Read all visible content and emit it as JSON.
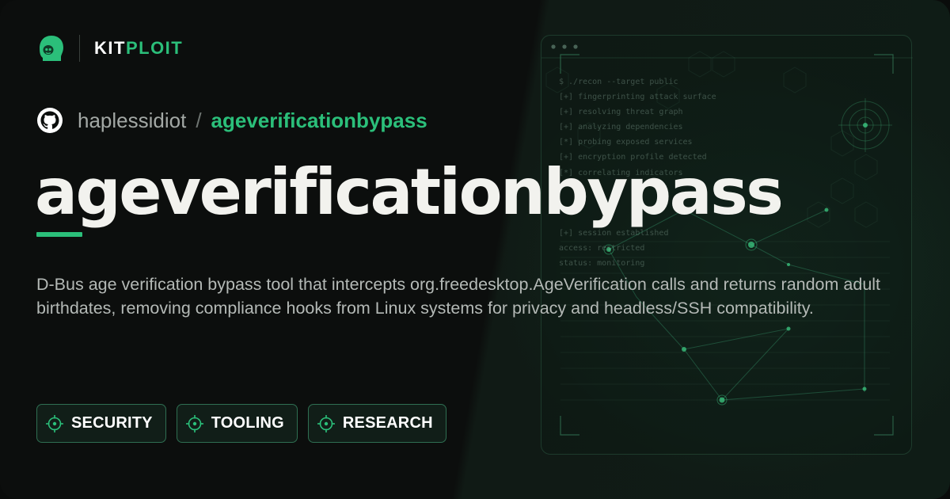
{
  "brand": {
    "part1": "KIT",
    "part2": "PLOIT",
    "logo_icon": "kitploit-helmet-icon"
  },
  "repo": {
    "owner": "haplessidiot",
    "separator": "/",
    "name": "ageverificationbypass",
    "icon": "github-icon"
  },
  "title": "ageverificationbypass",
  "description": "D-Bus age verification bypass tool that intercepts org.freedesktop.AgeVerification calls and returns random adult birthdates, removing compliance hooks from Linux systems for privacy and headless/SSH compatibility.",
  "tags": [
    {
      "label": "SECURITY",
      "icon": "crosshair-icon"
    },
    {
      "label": "TOOLING",
      "icon": "crosshair-icon"
    },
    {
      "label": "RESEARCH",
      "icon": "crosshair-icon"
    }
  ],
  "terminal": {
    "lines": [
      "$ ./recon --target public",
      "[+] fingerprinting attack surface",
      "[+] resolving threat graph",
      "[+] analyzing dependencies",
      "[*] probing exposed services",
      "[+] encryption profile detected",
      "[*] correlating indicators",
      "",
      "",
      "",
      "[+] session established",
      "access: restricted",
      "status: monitoring"
    ]
  },
  "colors": {
    "accent": "#2bbf7a",
    "background": "#0b0d0c",
    "title": "#f2f2ee",
    "muted": "#a3a8a5"
  }
}
